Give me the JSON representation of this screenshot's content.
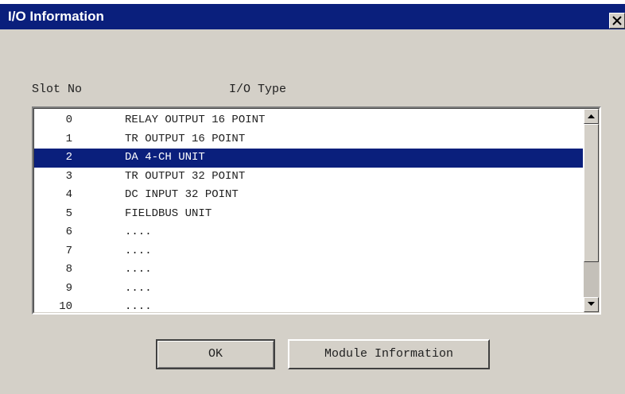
{
  "window": {
    "title": "I/O Information",
    "close_icon": "close-icon"
  },
  "headers": {
    "slot": "Slot No",
    "type": "I/O Type"
  },
  "list": {
    "selected_index": 2,
    "rows": [
      {
        "slot": "0",
        "type": "RELAY OUTPUT 16 POINT"
      },
      {
        "slot": "1",
        "type": "TR OUTPUT 16 POINT"
      },
      {
        "slot": "2",
        "type": "DA 4-CH UNIT"
      },
      {
        "slot": "3",
        "type": "TR OUTPUT 32 POINT"
      },
      {
        "slot": "4",
        "type": "DC INPUT 32 POINT"
      },
      {
        "slot": "5",
        "type": "FIELDBUS UNIT"
      },
      {
        "slot": "6",
        "type": "...."
      },
      {
        "slot": "7",
        "type": "...."
      },
      {
        "slot": "8",
        "type": "...."
      },
      {
        "slot": "9",
        "type": "...."
      },
      {
        "slot": "10",
        "type": "...."
      }
    ]
  },
  "buttons": {
    "ok": "OK",
    "module_information": "Module Information"
  },
  "colors": {
    "title_bar": "#0a1f7c",
    "selection": "#0a1f7c",
    "face": "#d4d0c8"
  }
}
